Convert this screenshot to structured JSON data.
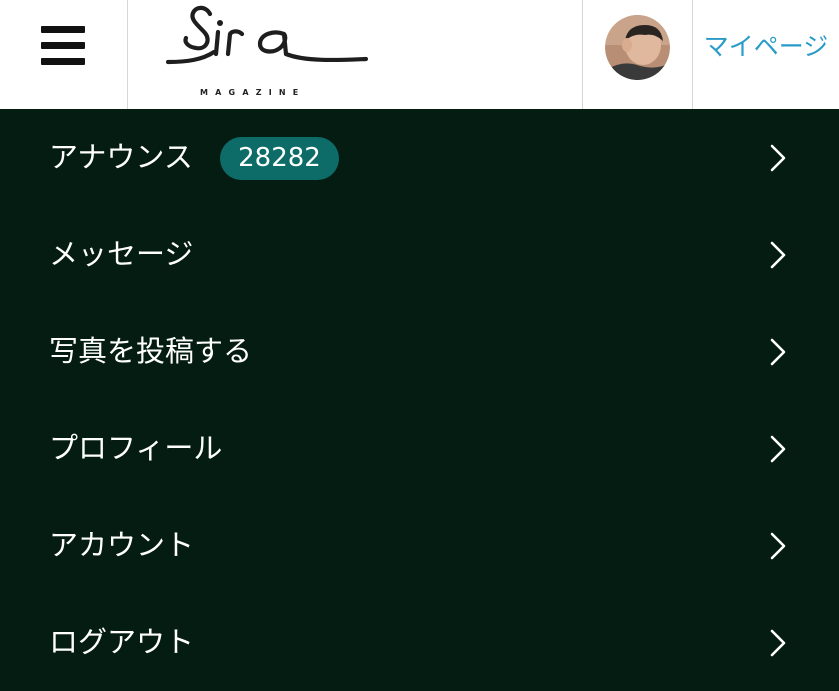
{
  "header": {
    "logo_tagline": "MAGAZINE",
    "mypage_label": "マイページ"
  },
  "menu": {
    "items": [
      {
        "label": "アナウンス",
        "badge": "28282"
      },
      {
        "label": "メッセージ"
      },
      {
        "label": "写真を投稿する"
      },
      {
        "label": "プロフィール"
      },
      {
        "label": "アカウント"
      },
      {
        "label": "ログアウト"
      }
    ]
  },
  "colors": {
    "menu_background": "#041c12",
    "badge_background": "#0d6c67",
    "link_blue": "#2a9bc7"
  },
  "icons": {
    "menu": "hamburger-icon",
    "row_arrow": "chevron-right-icon"
  }
}
